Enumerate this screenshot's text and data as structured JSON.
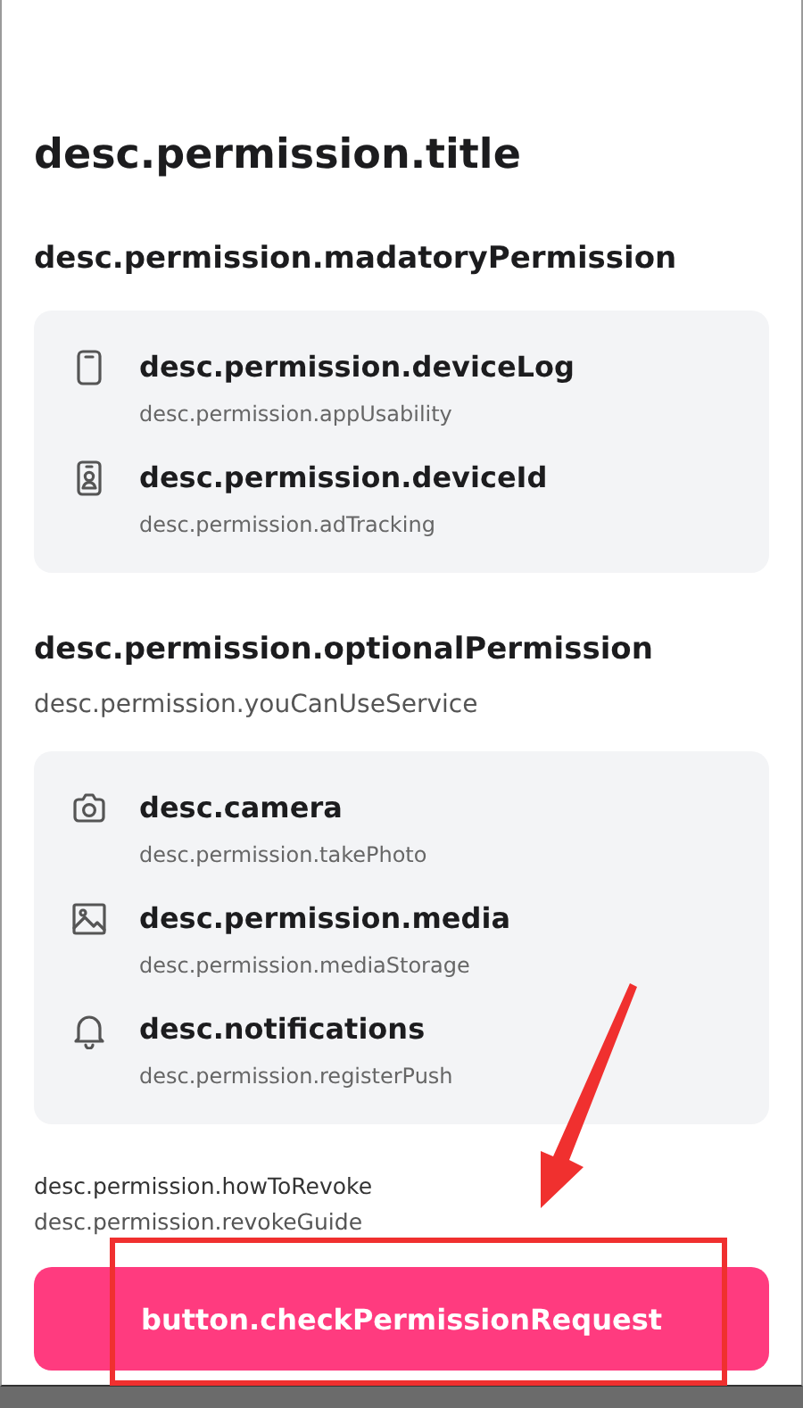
{
  "title": "desc.permission.title",
  "sections": [
    {
      "heading": "desc.permission.madatoryPermission",
      "items": [
        {
          "name": "desc.permission.deviceLog",
          "description": "desc.permission.appUsability"
        },
        {
          "name": "desc.permission.deviceId",
          "description": "desc.permission.adTracking"
        }
      ]
    },
    {
      "heading": "desc.permission.optionalPermission",
      "subtitle": "desc.permission.youCanUseService",
      "items": [
        {
          "name": "desc.camera",
          "description": "desc.permission.takePhoto"
        },
        {
          "name": "desc.permission.media",
          "description": "desc.permission.mediaStorage"
        },
        {
          "name": "desc.notifications",
          "description": "desc.permission.registerPush"
        }
      ]
    }
  ],
  "revoke": {
    "heading": "desc.permission.howToRevoke",
    "guide": "desc.permission.revokeGuide"
  },
  "button": "button.checkPermissionRequest"
}
